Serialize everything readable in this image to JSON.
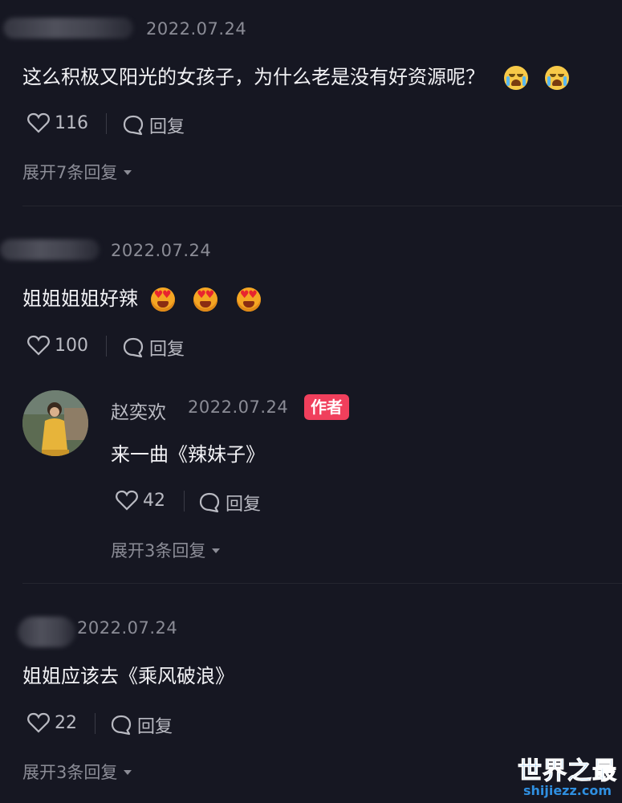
{
  "comments": [
    {
      "date": "2022.07.24",
      "text": "这么积极又阳光的女孩子，为什么老是没有好资源呢？",
      "emojis": [
        "crying-emoji",
        "crying-emoji"
      ],
      "likes": "116",
      "reply_label": "回复",
      "expand_label": "展开7条回复"
    },
    {
      "date": "2022.07.24",
      "text": "姐姐姐姐好辣",
      "emojis": [
        "heart-eyes-emoji",
        "heart-eyes-emoji",
        "heart-eyes-emoji"
      ],
      "likes": "100",
      "reply_label": "回复",
      "reply": {
        "author": "赵奕欢",
        "date": "2022.07.24",
        "badge": "作者",
        "text": "来一曲《辣妹子》",
        "likes": "42",
        "reply_label": "回复",
        "expand_label": "展开3条回复"
      }
    },
    {
      "date": "2022.07.24",
      "text": "姐姐应该去《乘风破浪》",
      "likes": "22",
      "reply_label": "回复",
      "expand_label": "展开3条回复"
    }
  ],
  "watermark": {
    "title": "世界之最",
    "site": "shijiezz.com"
  },
  "colors": {
    "background": "#161722",
    "badge": "#f03f5c",
    "muted": "#8b8c96"
  }
}
